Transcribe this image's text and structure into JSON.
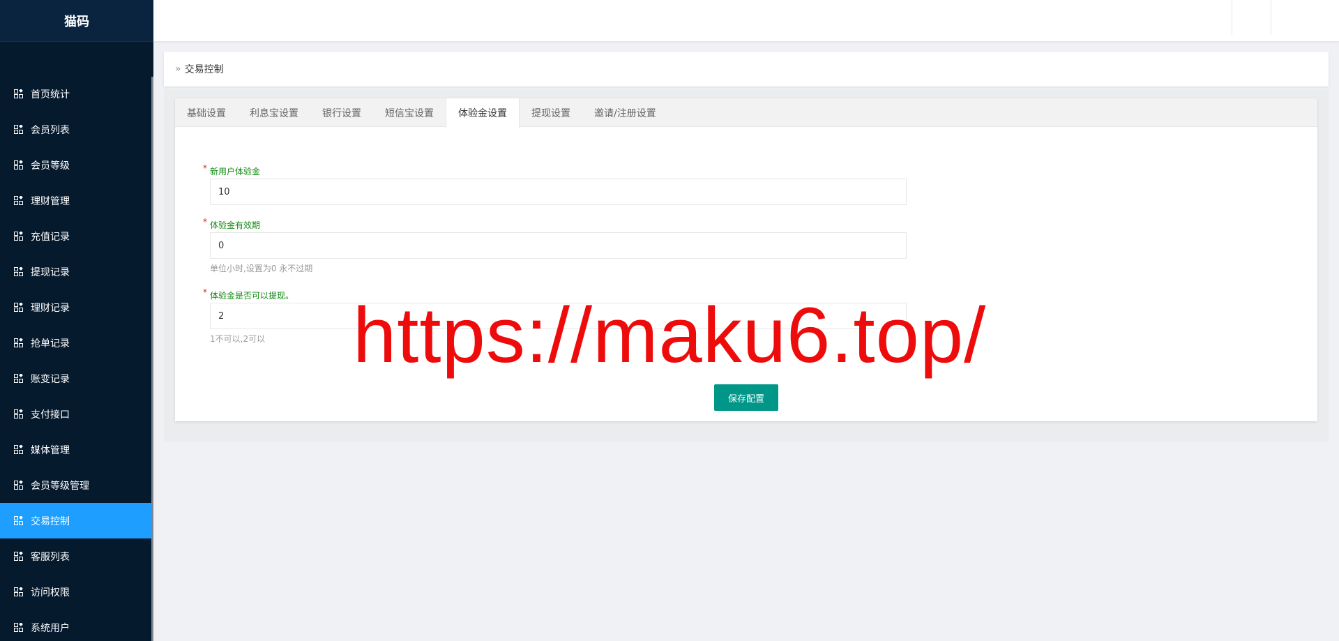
{
  "app": {
    "logo_text": "猫码"
  },
  "sidebar": {
    "items": [
      {
        "label": "首页统计",
        "icon": "dashboard-grid-icon"
      },
      {
        "label": "会员列表",
        "icon": "dashboard-grid-icon"
      },
      {
        "label": "会员等级",
        "icon": "dashboard-grid-icon"
      },
      {
        "label": "理财管理",
        "icon": "dashboard-grid-icon"
      },
      {
        "label": "充值记录",
        "icon": "dashboard-grid-icon"
      },
      {
        "label": "提现记录",
        "icon": "dashboard-grid-icon"
      },
      {
        "label": "理财记录",
        "icon": "dashboard-grid-icon"
      },
      {
        "label": "抢单记录",
        "icon": "dashboard-grid-icon"
      },
      {
        "label": "账变记录",
        "icon": "dashboard-grid-icon"
      },
      {
        "label": "支付接口",
        "icon": "dashboard-grid-icon"
      },
      {
        "label": "媒体管理",
        "icon": "dashboard-grid-icon"
      },
      {
        "label": "会员等级管理",
        "icon": "dashboard-grid-icon"
      },
      {
        "label": "交易控制",
        "icon": "dashboard-grid-icon",
        "active": true
      },
      {
        "label": "客服列表",
        "icon": "dashboard-grid-icon"
      },
      {
        "label": "访问权限",
        "icon": "dashboard-grid-icon"
      },
      {
        "label": "系统用户",
        "icon": "dashboard-grid-icon"
      }
    ]
  },
  "breadcrumb": {
    "icon": "double-chevron-right-icon",
    "text": "交易控制"
  },
  "tabs": [
    {
      "label": "基础设置"
    },
    {
      "label": "利息宝设置"
    },
    {
      "label": "银行设置"
    },
    {
      "label": "短信宝设置"
    },
    {
      "label": "体验金设置",
      "active": true
    },
    {
      "label": "提现设置"
    },
    {
      "label": "邀请/注册设置"
    }
  ],
  "form": {
    "fields": [
      {
        "label": "新用户体验金",
        "value": "10",
        "help": ""
      },
      {
        "label": "体验金有效期",
        "value": "0",
        "help": "单位小时,设置为0 永不过期"
      },
      {
        "label": "体验金是否可以提现。",
        "value": "2",
        "help": "1不可以,2可以"
      }
    ],
    "save_label": "保存配置"
  },
  "watermark": {
    "text": "https://maku6.top/"
  },
  "colors": {
    "sidebar_bg": "#061a2e",
    "active_item": "#1e9fff",
    "label_green": "#118a11",
    "required_star": "#e02020",
    "save_button": "#009688",
    "watermark": "#ee0b0b"
  }
}
